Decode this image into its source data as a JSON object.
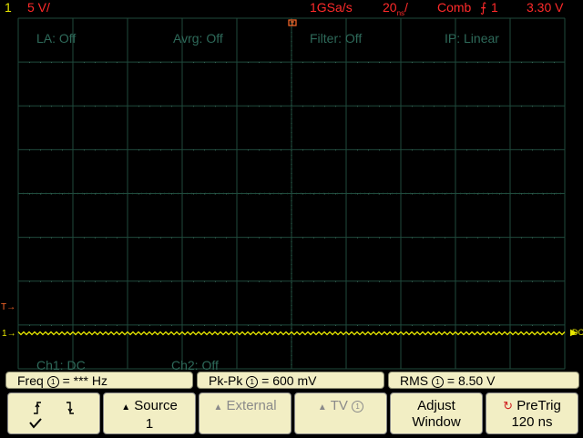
{
  "status_bar": {
    "channel": "1",
    "scale": "5 V/",
    "sample_rate": "1GSa/s",
    "timebase": "20",
    "timebase_unit": "ns",
    "trigger_mode": "Comb",
    "trigger_source": "1",
    "trigger_level": "3.30 V"
  },
  "grid_labels": {
    "la": "LA: Off",
    "avrg": "Avrg: Off",
    "filter": "Filter: Off",
    "ip": "IP: Linear",
    "ch1": "Ch1: DC",
    "ch2": "Ch2: Off"
  },
  "markers": {
    "channel_marker": "1",
    "trigger_marker": "T",
    "coupling_marker": "DC"
  },
  "measurements": [
    {
      "label": "Freq",
      "value": "= *** Hz"
    },
    {
      "label": "Pk-Pk",
      "value": "= 600 mV"
    },
    {
      "label": "RMS",
      "value": "=  8.50  V"
    }
  ],
  "softkeys": {
    "slope": {
      "rise": "rising-edge-icon",
      "fall": "falling-edge-icon"
    },
    "source": {
      "label": "Source",
      "value": "1"
    },
    "external": {
      "label": "External"
    },
    "tv": {
      "label": "TV"
    },
    "adjust": {
      "label": "Adjust",
      "value": "Window"
    },
    "pretrig": {
      "label": "PreTrig",
      "value": "120 ns"
    }
  },
  "colors": {
    "trace": "#e8e800",
    "grid": "#1f4a3c",
    "panel": "#f2eec4",
    "alert": "#ff2a2a"
  }
}
